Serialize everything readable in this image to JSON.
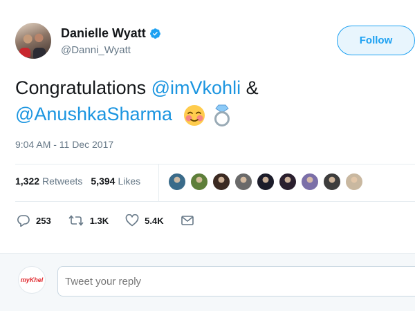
{
  "author": {
    "name": "Danielle Wyatt",
    "handle": "@Danni_Wyatt",
    "verified": true
  },
  "follow_label": "Follow",
  "tweet": {
    "text_prefix": "Congratulations ",
    "mention1": "@imVkohli",
    "connector": " &",
    "mention2": "@AnushkaSharma",
    "emojis": [
      "blushing-face-emoji",
      "ring-emoji"
    ]
  },
  "timestamp": "9:04 AM - 11 Dec 2017",
  "stats": {
    "retweets_count": "1,322",
    "retweets_label": "Retweets",
    "likes_count": "5,394",
    "likes_label": "Likes"
  },
  "likers": [
    "#3a6b8a",
    "#5e7f3a",
    "#3b2a22",
    "#6a6a6a",
    "#1c1c2a",
    "#2a1f2e",
    "#7b6fa8",
    "#3d3d3d",
    "#c9b8a0"
  ],
  "actions": {
    "replies": "253",
    "retweets": "1.3K",
    "likes": "5.4K"
  },
  "reply": {
    "avatar_text": "myKhel",
    "placeholder": "Tweet your reply"
  },
  "colors": {
    "accent": "#1da1f2",
    "mention": "#1b95e0",
    "muted": "#657786"
  }
}
